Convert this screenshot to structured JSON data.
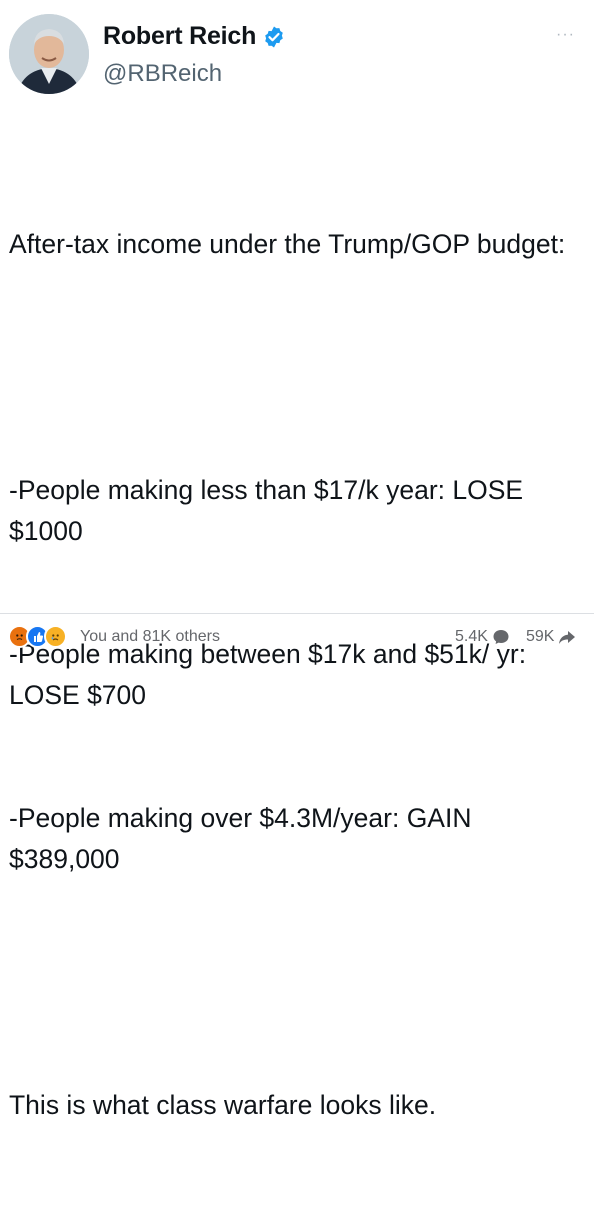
{
  "author": {
    "display_name": "Robert Reich",
    "handle": "@RBReich",
    "verified": true,
    "avatar_icon": "profile-photo"
  },
  "more_label": "···",
  "tweet": {
    "lines": [
      "After-tax income under the Trump/GOP budget:",
      "",
      "-People making less than $17/k year: LOSE $1000",
      "-People making between $17k and $51k/ yr: LOSE $700",
      "-People making over $4.3M/year: GAIN $389,000",
      "",
      "This is what class warfare looks like."
    ]
  },
  "footer": {
    "reactions": [
      "angry",
      "like",
      "sad"
    ],
    "reaction_text": "You and 81K others",
    "comments": "5.4K",
    "shares": "59K"
  },
  "colors": {
    "verified": "#1d9bf0",
    "text": "#0f1419",
    "secondary": "#536471",
    "footer_text": "#65676b"
  }
}
